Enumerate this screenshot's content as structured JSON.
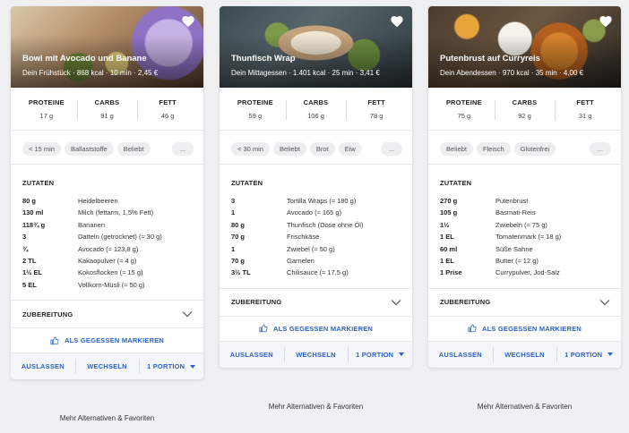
{
  "cards": [
    {
      "title": "Bowl mit Avocado und Banane",
      "subtitle": "Dein Frühstück · 868 kcal · 10 min · 2,45 €",
      "macros": [
        {
          "label": "PROTEINE",
          "value": "17 g"
        },
        {
          "label": "CARBS",
          "value": "91 g"
        },
        {
          "label": "FETT",
          "value": "46 g"
        }
      ],
      "tags": [
        "< 15 min",
        "Ballaststoffe",
        "Beliebt"
      ],
      "tags_more": "...",
      "ingredients_title": "ZUTATEN",
      "ingredients": [
        {
          "amount": "80 g",
          "name": "Heidelbeeren"
        },
        {
          "amount": "130 ml",
          "name": "Milch (fettarm, 1,5% Fett)"
        },
        {
          "amount": "118¾ g",
          "name": "Bananen"
        },
        {
          "amount": "3",
          "name": "Datteln (getrocknet) (≈ 30 g)"
        },
        {
          "amount": "¾",
          "name": "Avocado (≈ 123,8 g)"
        },
        {
          "amount": "2 TL",
          "name": "Kakaopulver (≈ 4 g)"
        },
        {
          "amount": "1½ EL",
          "name": "Kokosflocken (≈ 15 g)"
        },
        {
          "amount": "5 EL",
          "name": "Vollkorn-Müsli (≈ 50 g)"
        }
      ],
      "prep_label": "ZUBEREITUNG",
      "mark_label": "ALS GEGESSEN MARKIEREN",
      "actions": {
        "skip": "AUSLASSEN",
        "swap": "WECHSELN",
        "portion": "1 PORTION"
      },
      "more_link": "Mehr Alternativen & Favoriten"
    },
    {
      "title": "Thunfisch Wrap",
      "subtitle": "Dein Mittagessen · 1.401 kcal · 25 min · 3,41 €",
      "macros": [
        {
          "label": "PROTEINE",
          "value": "59 g"
        },
        {
          "label": "CARBS",
          "value": "106 g"
        },
        {
          "label": "FETT",
          "value": "78 g"
        }
      ],
      "tags": [
        "< 30 min",
        "Beliebt",
        "Brot",
        "Eiw"
      ],
      "tags_more": "...",
      "ingredients_title": "ZUTATEN",
      "ingredients": [
        {
          "amount": "3",
          "name": "Tortilla Wraps (≈ 180 g)"
        },
        {
          "amount": "1",
          "name": "Avocado (≈ 165 g)"
        },
        {
          "amount": "80 g",
          "name": "Thunfisch (Dose ohne Öl)"
        },
        {
          "amount": "70 g",
          "name": "Frischkäse"
        },
        {
          "amount": "1",
          "name": "Zwiebel (≈ 50 g)"
        },
        {
          "amount": "70 g",
          "name": "Garnelen"
        },
        {
          "amount": "3½ TL",
          "name": "Chilisauce (≈ 17,5 g)"
        }
      ],
      "prep_label": "ZUBEREITUNG",
      "mark_label": "ALS GEGESSEN MARKIEREN",
      "actions": {
        "skip": "AUSLASSEN",
        "swap": "WECHSELN",
        "portion": "1 PORTION"
      },
      "more_link": "Mehr Alternativen & Favoriten"
    },
    {
      "title": "Putenbrust auf Curryreis",
      "subtitle": "Dein Abendessen · 970 kcal · 35 min · 4,00 €",
      "macros": [
        {
          "label": "PROTEINE",
          "value": "75 g"
        },
        {
          "label": "CARBS",
          "value": "92 g"
        },
        {
          "label": "FETT",
          "value": "31 g"
        }
      ],
      "tags": [
        "Beliebt",
        "Fleisch",
        "Glutenfrei"
      ],
      "tags_more": "...",
      "ingredients_title": "ZUTATEN",
      "ingredients": [
        {
          "amount": "270 g",
          "name": "Putenbrust"
        },
        {
          "amount": "105 g",
          "name": "Basmati-Reis"
        },
        {
          "amount": "1½",
          "name": "Zwiebeln (≈ 75 g)"
        },
        {
          "amount": "1 EL",
          "name": "Tomatenmark (≈ 18 g)"
        },
        {
          "amount": "60 ml",
          "name": "Süße Sahne"
        },
        {
          "amount": "1 EL",
          "name": "Butter (≈ 12 g)"
        },
        {
          "amount": "1 Prise",
          "name": "Currypulver, Jod-Salz"
        }
      ],
      "prep_label": "ZUBEREITUNG",
      "mark_label": "ALS GEGESSEN MARKIEREN",
      "actions": {
        "skip": "AUSLASSEN",
        "swap": "WECHSELN",
        "portion": "1 PORTION"
      },
      "more_link": "Mehr Alternativen & Favoriten"
    }
  ],
  "icons": {
    "favorite": "heart-icon",
    "expand": "chevron-down-icon",
    "mark": "thumbs-up-icon",
    "dropdown": "caret-down-icon"
  },
  "colors": {
    "accent": "#2c62c5",
    "background": "#eef0f2",
    "tag_bg": "#eceef0"
  }
}
